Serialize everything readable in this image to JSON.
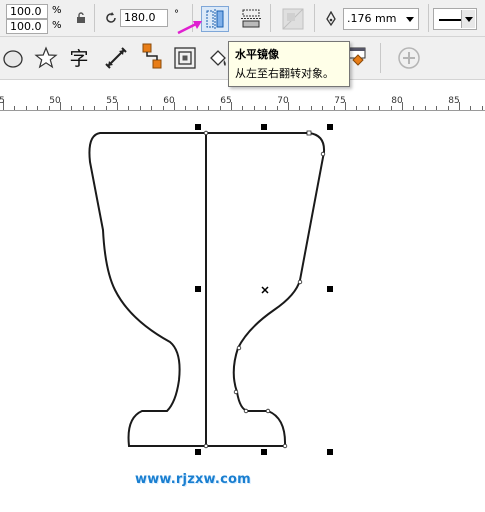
{
  "property_bar": {
    "scale_x": "100.0",
    "scale_y": "100.0",
    "percent_x": "%",
    "percent_y": "%",
    "rotation_value": "180.0",
    "rotation_unit": "°",
    "outline_width": ".176 mm"
  },
  "tooltip": {
    "title": "水平镜像",
    "description": "从左至右翻转对象。"
  },
  "toolbar2": {
    "text_tool_glyph": "字"
  },
  "ruler": {
    "labels": [
      "5",
      "50",
      "55",
      "60",
      "65",
      "70",
      "75",
      "80",
      "85"
    ]
  },
  "watermark": "www.rjzxw.com",
  "colors": {
    "accent_orange": "#e87d17",
    "arrow_magenta": "#e020d0",
    "watermark_blue": "#1a7fd0"
  }
}
